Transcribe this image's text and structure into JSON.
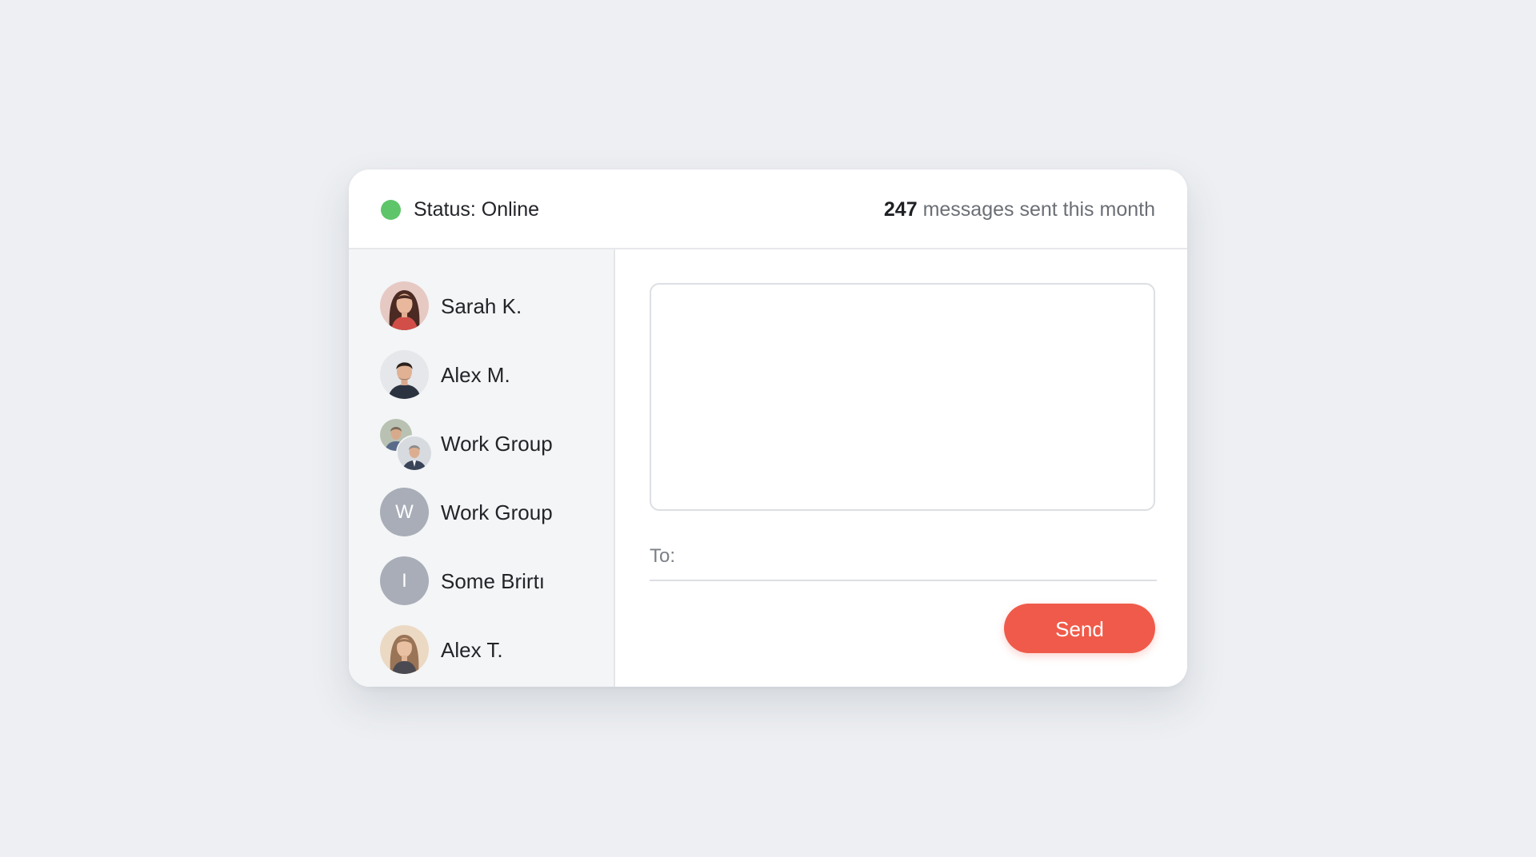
{
  "header": {
    "status_label": "Status: Online",
    "status_color": "#5ec56a",
    "messages_count": "247",
    "messages_suffix": " messages sent this month"
  },
  "contacts": [
    {
      "name": "Sarah K.",
      "avatar": "photo-woman-dark-hair-icon"
    },
    {
      "name": "Alex M.",
      "avatar": "photo-man-icon"
    },
    {
      "name": "Work Group",
      "avatar": "group-photos-icon"
    },
    {
      "name": "Work Group",
      "avatar": "initial-avatar",
      "initial": "W"
    },
    {
      "name": "Some Brirtı",
      "avatar": "initial-avatar",
      "initial": "I"
    },
    {
      "name": "Alex T.",
      "avatar": "photo-woman-light-hair-icon"
    }
  ],
  "compose": {
    "message_value": "",
    "to_label": "To:",
    "to_value": "",
    "send_label": "Send",
    "send_color": "#f05a4a"
  }
}
